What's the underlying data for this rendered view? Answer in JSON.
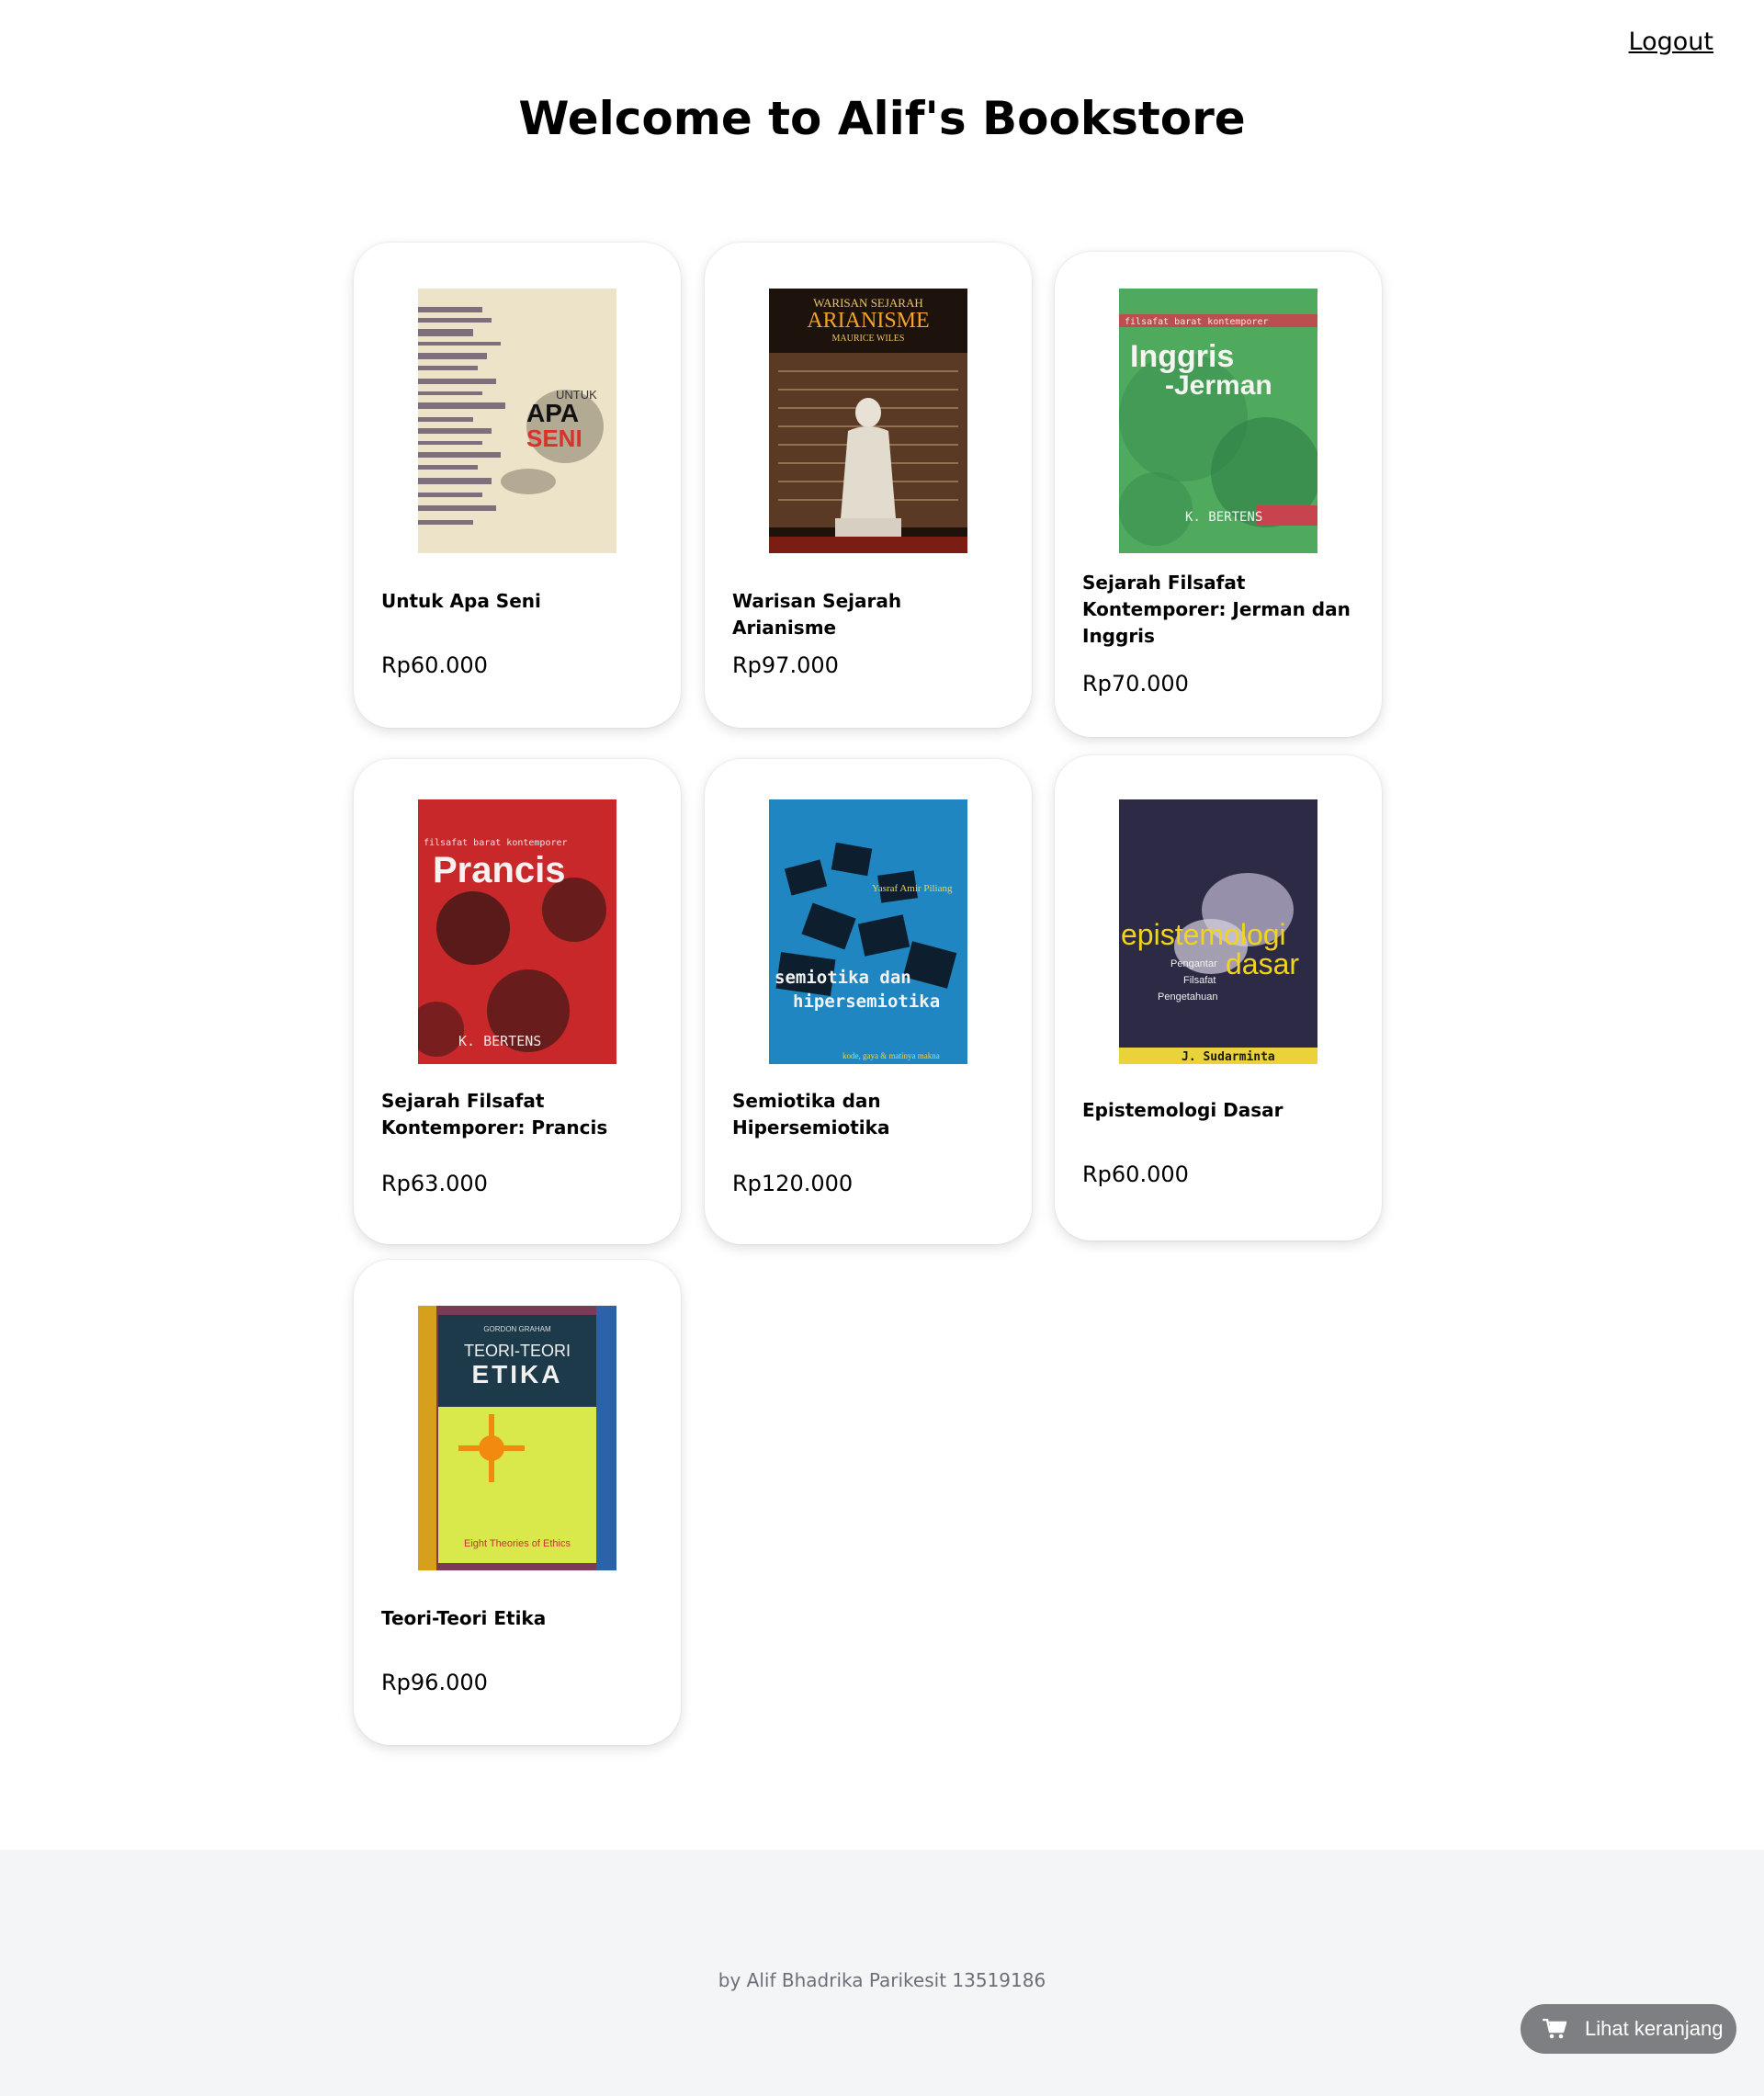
{
  "header": {
    "logout_label": "Logout",
    "title": "Welcome to Alif's Bookstore"
  },
  "books": [
    {
      "title": "Untuk Apa Seni",
      "price": "Rp60.000",
      "cover_lines": [
        "UNTUK",
        "APA",
        "SENI"
      ]
    },
    {
      "title": "Warisan Sejarah Arianisme",
      "price": "Rp97.000",
      "cover_lines": [
        "WARISAN SEJARAH",
        "ARIANISME",
        "MAURICE WILES"
      ]
    },
    {
      "title": "Sejarah Filsafat Kontemporer: Jerman dan Inggris",
      "price": "Rp70.000",
      "cover_lines": [
        "filsafat barat kontemporer",
        "Inggris",
        "-Jerman",
        "K. BERTENS"
      ]
    },
    {
      "title": "Sejarah Filsafat Kontemporer: Prancis",
      "price": "Rp63.000",
      "cover_lines": [
        "filsafat barat kontemporer",
        "Prancis",
        "K. BERTENS"
      ]
    },
    {
      "title": "Semiotika dan Hipersemiotika",
      "price": "Rp120.000",
      "cover_lines": [
        "Yasraf Amir Piliang",
        "semiotika dan",
        "hipersemiotika",
        "kode, gaya & matinya makna"
      ]
    },
    {
      "title": "Epistemologi Dasar",
      "price": "Rp60.000",
      "cover_lines": [
        "epistemologi",
        "dasar",
        "Pengantar",
        "Filsafat",
        "Pengetahuan",
        "J. Sudarminta"
      ]
    },
    {
      "title": "Teori-Teori Etika",
      "price": "Rp96.000",
      "cover_lines": [
        "GORDON GRAHAM",
        "TEORI-TEORI",
        "ETIKA",
        "Eight Theories of Ethics"
      ]
    }
  ],
  "footer": {
    "credit": "by Alif Bhadrika Parikesit 13519186"
  },
  "cart": {
    "label": "Lihat keranjang",
    "icon": "shopping-cart-icon"
  },
  "colors": {
    "card_bg": "#ffffff",
    "footer_bg": "#f4f5f7",
    "cart_button_bg": "#7d7f82"
  }
}
